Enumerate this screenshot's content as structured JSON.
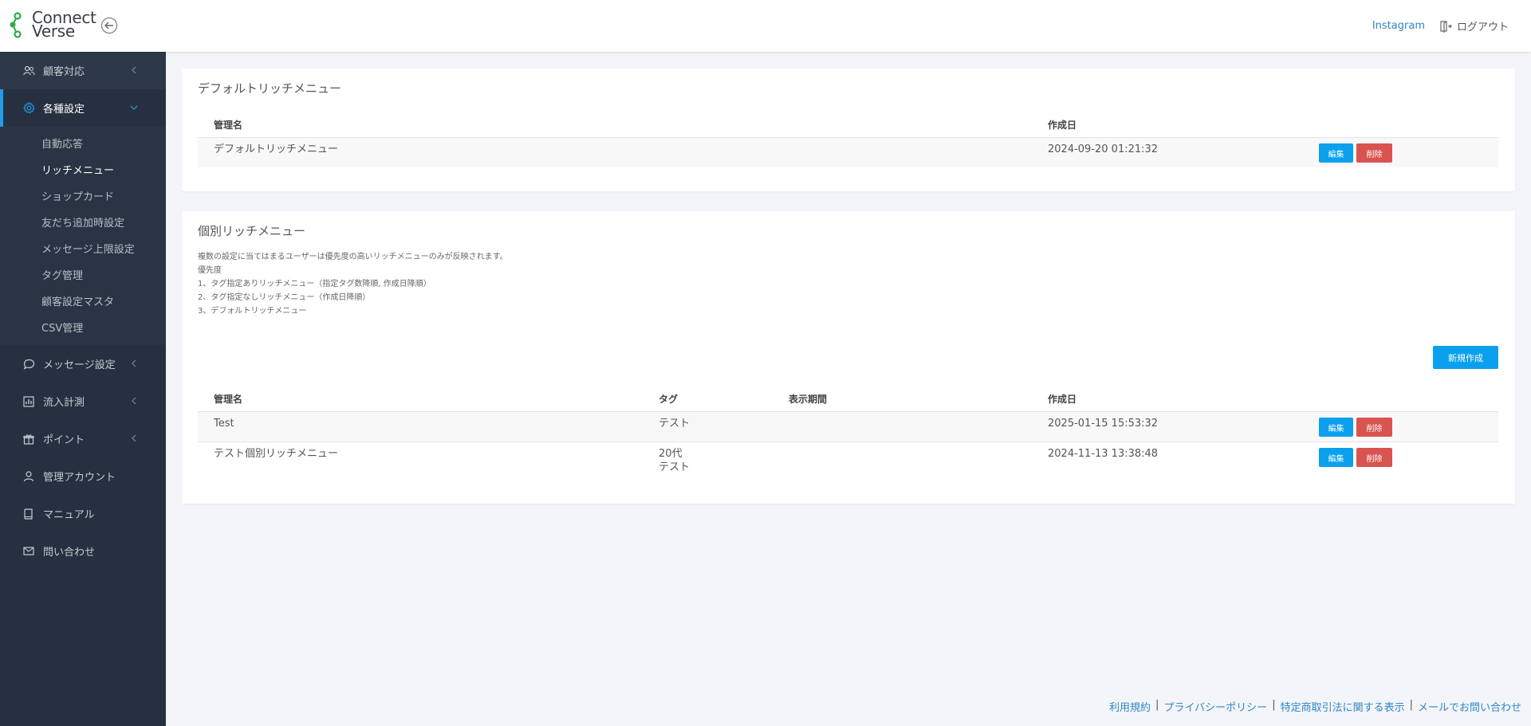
{
  "brand": {
    "line1": "Connect",
    "line2": "Verse",
    "color": "#2eaa4a"
  },
  "header": {
    "instagram": "Instagram",
    "logout": "ログアウト"
  },
  "sidebar": {
    "items": [
      {
        "label": "顧客対応",
        "icon": "users-icon"
      },
      {
        "label": "各種設定",
        "icon": "gear-icon"
      },
      {
        "label": "メッセージ設定",
        "icon": "chat-icon"
      },
      {
        "label": "流入計測",
        "icon": "bar-chart-icon"
      },
      {
        "label": "ポイント",
        "icon": "gift-icon"
      },
      {
        "label": "管理アカウント",
        "icon": "user-icon"
      },
      {
        "label": "マニュアル",
        "icon": "book-icon"
      },
      {
        "label": "問い合わせ",
        "icon": "mail-icon"
      }
    ],
    "submenu": [
      "自動応答",
      "リッチメニュー",
      "ショップカード",
      "友だち追加時設定",
      "メッセージ上限設定",
      "タグ管理",
      "顧客設定マスタ",
      "CSV管理"
    ]
  },
  "default_card": {
    "title": "デフォルトリッチメニュー",
    "headers": {
      "name": "管理名",
      "created": "作成日"
    },
    "rows": [
      {
        "name": "デフォルトリッチメニュー",
        "created": "2024-09-20 01:21:32"
      }
    ]
  },
  "individual_card": {
    "title": "個別リッチメニュー",
    "notes": [
      "複数の設定に当てはまるユーザーは優先度の高いリッチメニューのみが反映されます。",
      "優先度",
      "1、タグ指定ありリッチメニュー（指定タグ数降順, 作成日降順）",
      "2、タグ指定なしリッチメニュー（作成日降順）",
      "3、デフォルトリッチメニュー"
    ],
    "new_button": "新規作成",
    "headers": {
      "name": "管理名",
      "tag": "タグ",
      "period": "表示期間",
      "created": "作成日"
    },
    "rows": [
      {
        "name": "Test",
        "tag1": "テスト",
        "tag2": "",
        "created": "2025-01-15 15:53:32"
      },
      {
        "name": "テスト個別リッチメニュー",
        "tag1": "20代",
        "tag2": "テスト",
        "created": "2024-11-13 13:38:48"
      }
    ]
  },
  "buttons": {
    "edit": "編集",
    "delete": "削除"
  },
  "footer": [
    "利用規約",
    "プライバシーポリシー",
    "特定商取引法に関する表示",
    "メールでお問い合わせ"
  ],
  "colors": {
    "accent": "#0aa0ee",
    "danger": "#d9534f",
    "sidebar": "#263040",
    "link": "#2d86c8"
  }
}
